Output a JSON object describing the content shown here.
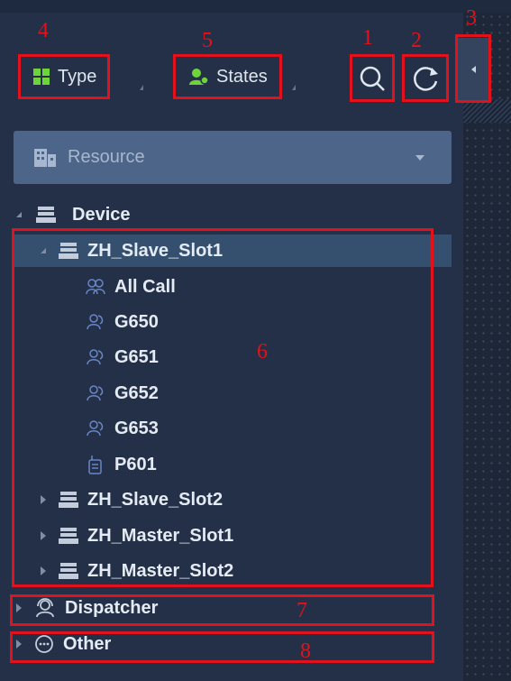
{
  "toolbar": {
    "type_label": "Type",
    "states_label": "States",
    "search_icon": "search-icon",
    "refresh_icon": "refresh-icon",
    "collapse_icon": "collapse-panel-icon"
  },
  "resource_filter": {
    "selected": "Resource"
  },
  "tree": {
    "device": "Device",
    "slave_slot1": "ZH_Slave_Slot1",
    "items": [
      "All Call",
      "G650",
      "G651",
      "G652",
      "G653",
      "P601"
    ],
    "slave_slot2": "ZH_Slave_Slot2",
    "master_slot1": "ZH_Master_Slot1",
    "master_slot2": "ZH_Master_Slot2",
    "dispatcher": "Dispatcher",
    "other": "Other"
  },
  "annotations": [
    "1",
    "2",
    "3",
    "4",
    "5",
    "6",
    "7",
    "8"
  ],
  "colors": {
    "accent_red": "#e1121b",
    "panel_bg": "#243047",
    "selection": "#35506f",
    "resource_bar": "#4c6588"
  }
}
